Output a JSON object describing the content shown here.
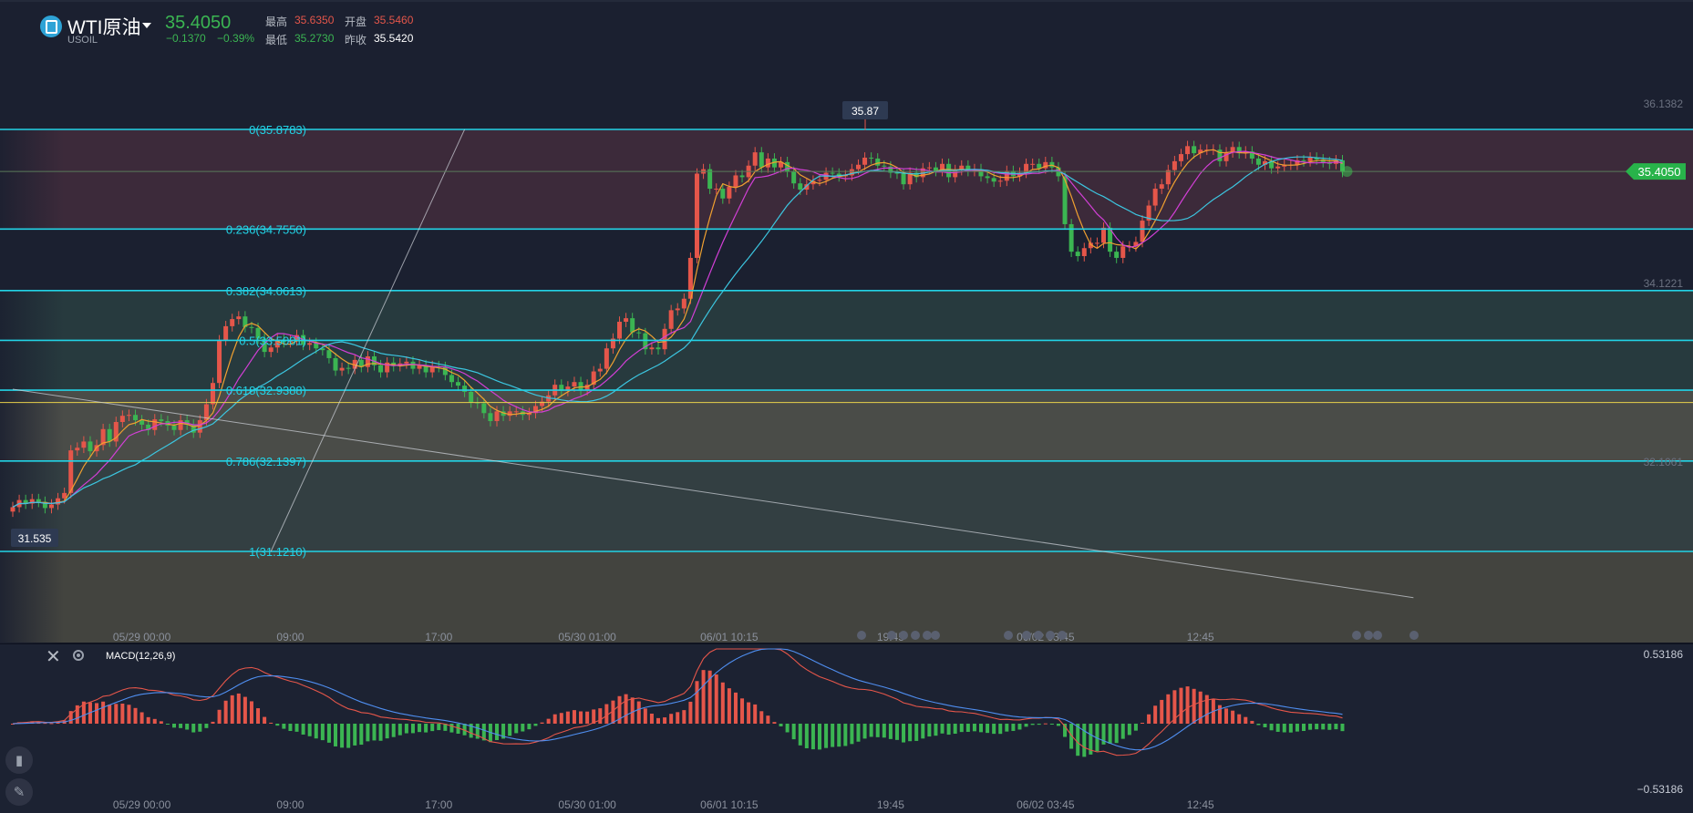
{
  "header": {
    "title": "WTI原油",
    "symbol": "USOIL",
    "price": "35.4050",
    "change": "−0.1370",
    "change_pct": "−0.39%",
    "high_label": "最高",
    "high": "35.6350",
    "open_label": "开盘",
    "open": "35.5460",
    "low_label": "最低",
    "low": "35.2730",
    "prev_label": "昨收",
    "prev_close": "35.5420"
  },
  "macd": {
    "title": "MACD(12,26,9)"
  },
  "colors": {
    "up": "#e5564a",
    "down": "#3bb552",
    "fib": "#22d3e6",
    "accent": "#28b34a",
    "bg": "#1b2030"
  },
  "icons": {
    "logo": "oil-logo-icon",
    "close": "close-icon",
    "settings": "gear-icon",
    "tool1": "candlestick-tool-icon",
    "tool2": "pencil-icon"
  },
  "chart_data": [
    {
      "type": "candlestick",
      "symbol": "USOIL",
      "ylim": [
        31.0,
        36.2
      ],
      "right_axis_ticks": [
        "36.1382",
        "34.1221",
        "32.1061"
      ],
      "current_price_label": "35.4050",
      "current_price": 35.405,
      "high_callout": "35.87",
      "low_callout": "31.535",
      "high_callout_value": 35.87,
      "low_callout_value": 31.535,
      "x_tick_labels": [
        "05/29 00:00",
        "09:00",
        "17:00",
        "05/30 01:00",
        "06/01 10:15",
        "19:45",
        "06/02 03:45",
        "12:45"
      ],
      "x_tick_index": [
        20,
        43,
        66,
        89,
        111,
        136,
        160,
        184
      ],
      "fibonacci": [
        {
          "label": "0(35.8783)",
          "value": 35.8783
        },
        {
          "label": "0.236(34.7550)",
          "value": 34.755
        },
        {
          "label": "0.382(34.0613)",
          "value": 34.0613
        },
        {
          "label": "0.5(33.5001)",
          "value": 33.5001
        },
        {
          "label": "0.618(32.9388)",
          "value": 32.9388
        },
        {
          "label": "0.786(32.1397)",
          "value": 32.1397
        },
        {
          "label": "1(31.1210)",
          "value": 31.121
        }
      ],
      "horizontal_line": 32.8,
      "trend_lines": [
        {
          "from": [
            40,
            31.121
          ],
          "to": [
            70,
            35.8783
          ]
        },
        {
          "from": [
            0,
            32.95
          ],
          "to": [
            217,
            30.6
          ]
        }
      ],
      "close": [
        31.62,
        31.7,
        31.66,
        31.71,
        31.68,
        31.61,
        31.65,
        31.72,
        31.78,
        32.26,
        32.29,
        32.36,
        32.25,
        32.32,
        32.5,
        32.36,
        32.58,
        32.65,
        32.66,
        32.6,
        32.55,
        32.49,
        32.61,
        32.59,
        32.54,
        32.49,
        32.6,
        32.55,
        32.46,
        32.6,
        32.78,
        33.02,
        33.5,
        33.66,
        33.74,
        33.77,
        33.65,
        33.64,
        33.52,
        33.37,
        33.42,
        33.51,
        33.48,
        33.5,
        33.56,
        33.45,
        33.47,
        33.41,
        33.39,
        33.3,
        33.16,
        33.19,
        33.18,
        33.28,
        33.2,
        33.32,
        33.22,
        33.14,
        33.25,
        33.21,
        33.24,
        33.26,
        33.18,
        33.22,
        33.14,
        33.21,
        33.2,
        33.11,
        33.03,
        32.99,
        32.92,
        32.8,
        32.79,
        32.68,
        32.59,
        32.7,
        32.65,
        32.7,
        32.7,
        32.66,
        32.68,
        32.76,
        32.81,
        32.88,
        33.0,
        32.93,
        32.98,
        33.03,
        32.94,
        33.0,
        33.15,
        33.18,
        33.41,
        33.52,
        33.71,
        33.75,
        33.59,
        33.58,
        33.4,
        33.42,
        33.4,
        33.63,
        33.84,
        33.86,
        33.97,
        34.43,
        35.38,
        35.43,
        35.21,
        35.21,
        35.1,
        35.23,
        35.36,
        35.34,
        35.47,
        35.62,
        35.45,
        35.55,
        35.45,
        35.51,
        35.4,
        35.27,
        35.2,
        35.26,
        35.3,
        35.31,
        35.39,
        35.38,
        35.35,
        35.36,
        35.43,
        35.48,
        35.56,
        35.55,
        35.47,
        35.46,
        35.39,
        35.38,
        35.26,
        35.39,
        35.34,
        35.44,
        35.45,
        35.41,
        35.49,
        35.34,
        35.42,
        35.47,
        35.41,
        35.43,
        35.35,
        35.33,
        35.29,
        35.3,
        35.41,
        35.35,
        35.39,
        35.49,
        35.49,
        35.44,
        35.51,
        35.45,
        35.35,
        34.81,
        34.5,
        34.45,
        34.54,
        34.6,
        34.6,
        34.77,
        34.5,
        34.43,
        34.56,
        34.56,
        34.61,
        34.85,
        35.02,
        35.21,
        35.26,
        35.42,
        35.52,
        35.6,
        35.69,
        35.61,
        35.65,
        35.65,
        35.65,
        35.52,
        35.62,
        35.68,
        35.61,
        35.63,
        35.55,
        35.48,
        35.52,
        35.44,
        35.46,
        35.48,
        35.48,
        35.53,
        35.52,
        35.56,
        35.54,
        35.51,
        35.49,
        35.53,
        35.4
      ]
    },
    {
      "type": "macd",
      "title": "MACD(12,26,9)",
      "ylim": [
        -0.53186,
        0.53186
      ],
      "axis_labels": [
        "0.53186",
        "−0.53186"
      ]
    }
  ]
}
